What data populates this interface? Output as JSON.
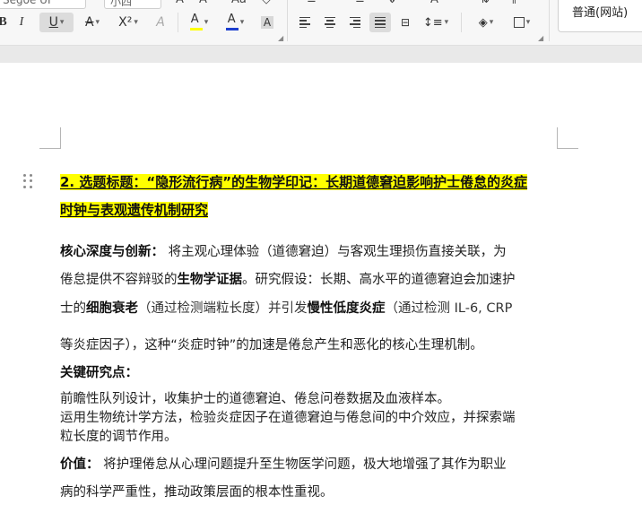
{
  "toolbar": {
    "font_name": "Segoe UI",
    "font_size": "小四",
    "style_name": "普通(网站)",
    "buttons": {
      "bold": "B",
      "italic": "I",
      "underline": "U",
      "strikethrough": "A",
      "superscript": "X²",
      "text_effect": "A",
      "highlight": "A",
      "font_color": "A",
      "char_shading": "A"
    },
    "highlight_color": "#ffff00",
    "font_color_bar": "#1e3fcf"
  },
  "document": {
    "heading": {
      "line1": "2. 选题标题：“隐形流行病”的生物学印记：长期道德窘迫影响护士倦怠的炎症",
      "line2": "时钟与表观遗传机制研究"
    },
    "para1": {
      "label": "核心深度与创新：",
      "s1": " 将主观心理体验（道德窘迫）与客观生理损伤直接关联，为",
      "s2": "倦怠提供不容辩驳的",
      "s2_bold": "生物学证据",
      "s3": "。研究假设：长期、高水平的道德窘迫会加速护",
      "s4": "士的",
      "s4_bold": "细胞衰老",
      "s5": "（通过检测端粒长度）并引发",
      "s5_bold": "慢性低度炎症",
      "s6": "（通过检测 IL-6, CRP",
      "s7": "等炎症因子），这种“炎症时钟”的加速是倦怠产生和恶化的核心生理机制。"
    },
    "key_points": {
      "label": "关键研究点：",
      "item1": "前瞻性队列设计，收集护士的道德窘迫、倦怠问卷数据及血液样本。",
      "item2a": "运用生物统计学方法，检验炎症因子在道德窘迫与倦怠间的中介效应，并探索端",
      "item2b": "粒长度的调节作用。"
    },
    "value": {
      "label": "价值：",
      "s1": " 将护理倦怠从心理问题提升至生物医学问题，极大地增强了其作为职业",
      "s2": "病的科学严重性，推动政策层面的根本性重视。"
    }
  }
}
